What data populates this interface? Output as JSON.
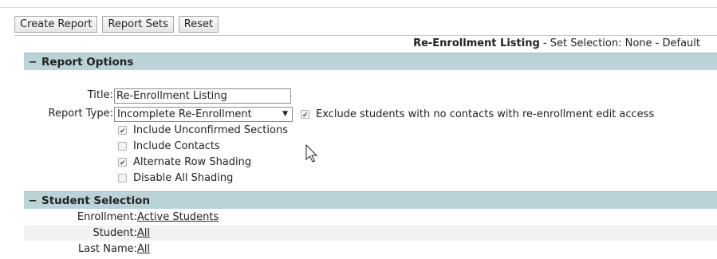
{
  "toolbar": {
    "create_report": "Create Report",
    "report_sets": "Report Sets",
    "reset": "Reset"
  },
  "header": {
    "report_name": "Re-Enrollment Listing",
    "set_info": " - Set Selection: None - Default"
  },
  "report_options": {
    "section_title": "Report Options",
    "toggle": "−",
    "title_label": "Title:",
    "title_value": "Re-Enrollment Listing",
    "report_type_label": "Report Type:",
    "report_type_value": "Incomplete Re-Enrollment",
    "exclude_label": "Exclude students with no contacts with re-enrollment edit access",
    "exclude_checked": true,
    "checkboxes": [
      {
        "label": "Include Unconfirmed Sections",
        "checked": true
      },
      {
        "label": "Include Contacts",
        "checked": false
      },
      {
        "label": "Alternate Row Shading",
        "checked": true
      },
      {
        "label": "Disable All Shading",
        "checked": false
      }
    ]
  },
  "student_selection": {
    "section_title": "Student Selection",
    "toggle": "−",
    "rows": [
      {
        "label": "Enrollment:",
        "value": "Active Students"
      },
      {
        "label": "Student:",
        "value": "All"
      },
      {
        "label": "Last Name:",
        "value": "All"
      }
    ]
  },
  "icons": {
    "cursor": "mouse-pointer-icon",
    "select_arrow": "dropdown-arrow-icon"
  }
}
